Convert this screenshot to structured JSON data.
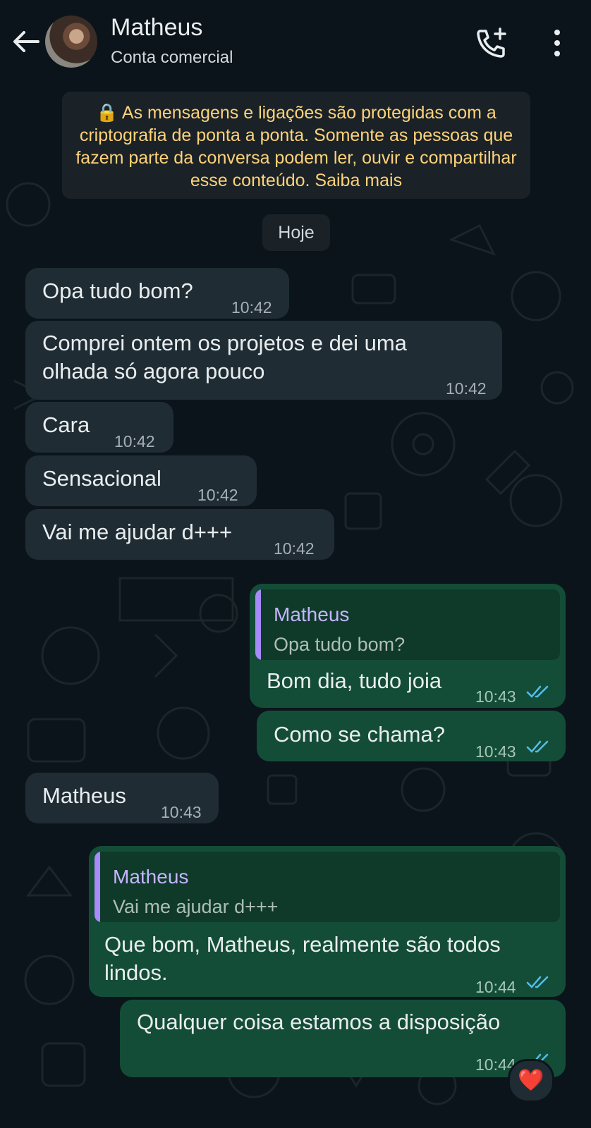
{
  "header": {
    "contact_name": "Matheus",
    "contact_subtitle": "Conta comercial"
  },
  "chat": {
    "encryption_notice": "🔒 As mensagens e ligações são protegidas com a criptografia de ponta a ponta. Somente as pessoas que fazem parte da conversa podem ler, ouvir e compartilhar esse conteúdo. Saiba mais",
    "date_label": "Hoje",
    "messages": [
      {
        "direction": "in",
        "text": "Opa tudo bom?",
        "time": "10:42"
      },
      {
        "direction": "in",
        "text_line1": "Comprei ontem os projetos e dei uma",
        "text_line2": "olhada só agora pouco",
        "time": "10:42"
      },
      {
        "direction": "in",
        "text": "Cara",
        "time": "10:42"
      },
      {
        "direction": "in",
        "text": "Sensacional",
        "time": "10:42"
      },
      {
        "direction": "in",
        "text": "Vai me ajudar d+++",
        "time": "10:42"
      },
      {
        "direction": "out",
        "quote_name": "Matheus",
        "quote_text": "Opa tudo bom?",
        "text": "Bom dia, tudo joia",
        "time": "10:43",
        "status": "read"
      },
      {
        "direction": "out",
        "text": "Como se chama?",
        "time": "10:43",
        "status": "read"
      },
      {
        "direction": "in",
        "text": "Matheus",
        "time": "10:43"
      },
      {
        "direction": "out",
        "quote_name": "Matheus",
        "quote_text": "Vai me ajudar d+++",
        "text_line1": "Que bom, Matheus, realmente são todos",
        "text_line2": "lindos.",
        "time": "10:44",
        "status": "read"
      },
      {
        "direction": "out",
        "text": "Qualquer coisa estamos a disposição",
        "time": "10:44",
        "status": "read",
        "reaction": "❤️"
      }
    ]
  },
  "colors": {
    "background": "#0b141a",
    "incoming_bubble": "#1f2c33",
    "outgoing_bubble": "#144d37",
    "notice_text": "#ffd279",
    "read_ticks": "#53bdeb",
    "quote_accent": "#a78bfa"
  },
  "icons": [
    "back-arrow-icon",
    "add-call-icon",
    "more-vert-icon",
    "lock-icon",
    "double-check-icon",
    "heart-reaction-icon"
  ]
}
